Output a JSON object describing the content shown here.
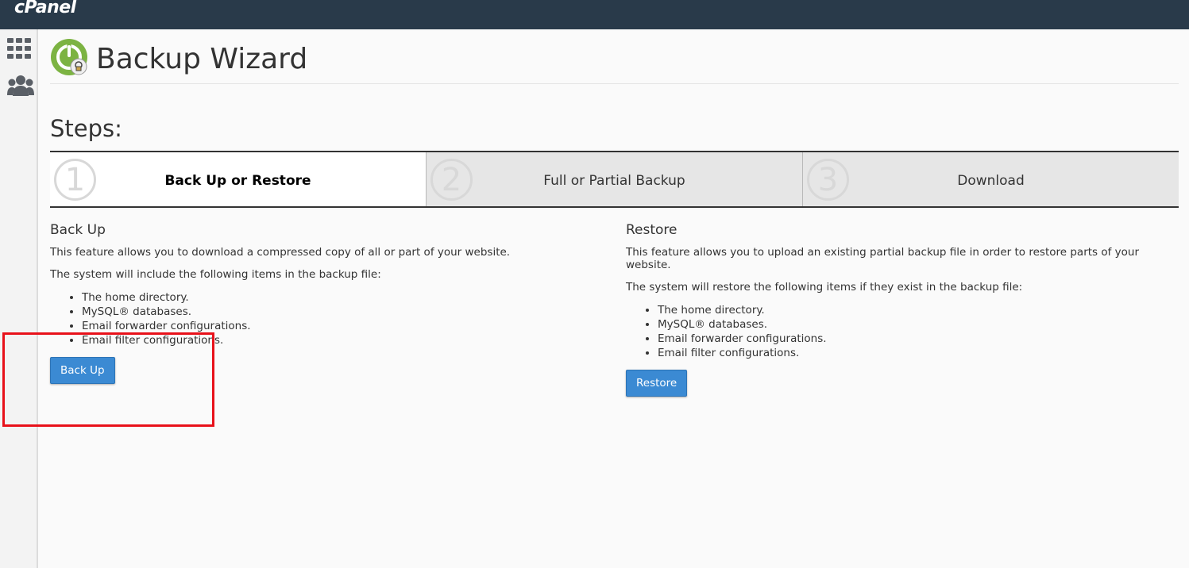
{
  "topbar": {
    "logo_text": "cPanel"
  },
  "sidebar": {
    "items": [
      {
        "icon": "grid-icon"
      },
      {
        "icon": "users-icon"
      }
    ]
  },
  "header": {
    "title": "Backup Wizard"
  },
  "steps": {
    "heading": "Steps:",
    "items": [
      {
        "number": "1",
        "label": "Back Up or Restore",
        "active": true
      },
      {
        "number": "2",
        "label": "Full or Partial Backup",
        "active": false
      },
      {
        "number": "3",
        "label": "Download",
        "active": false
      }
    ]
  },
  "backup": {
    "title": "Back Up",
    "description": "This feature allows you to download a compressed copy of all or part of your website.",
    "intro": "The system will include the following items in the backup file:",
    "items": [
      "The home directory.",
      "MySQL® databases.",
      "Email forwarder configurations.",
      "Email filter configurations."
    ],
    "button_label": "Back Up"
  },
  "restore": {
    "title": "Restore",
    "description": "This feature allows you to upload an existing partial backup file in order to restore parts of your website.",
    "intro": "The system will restore the following items if they exist in the backup file:",
    "items": [
      "The home directory.",
      "MySQL® databases.",
      "Email forwarder configurations.",
      "Email filter configurations."
    ],
    "button_label": "Restore"
  },
  "colors": {
    "topbar": "#293a4a",
    "button": "#3b8ad3",
    "highlight": "#e8111a",
    "app_icon_green": "#7cb342"
  }
}
